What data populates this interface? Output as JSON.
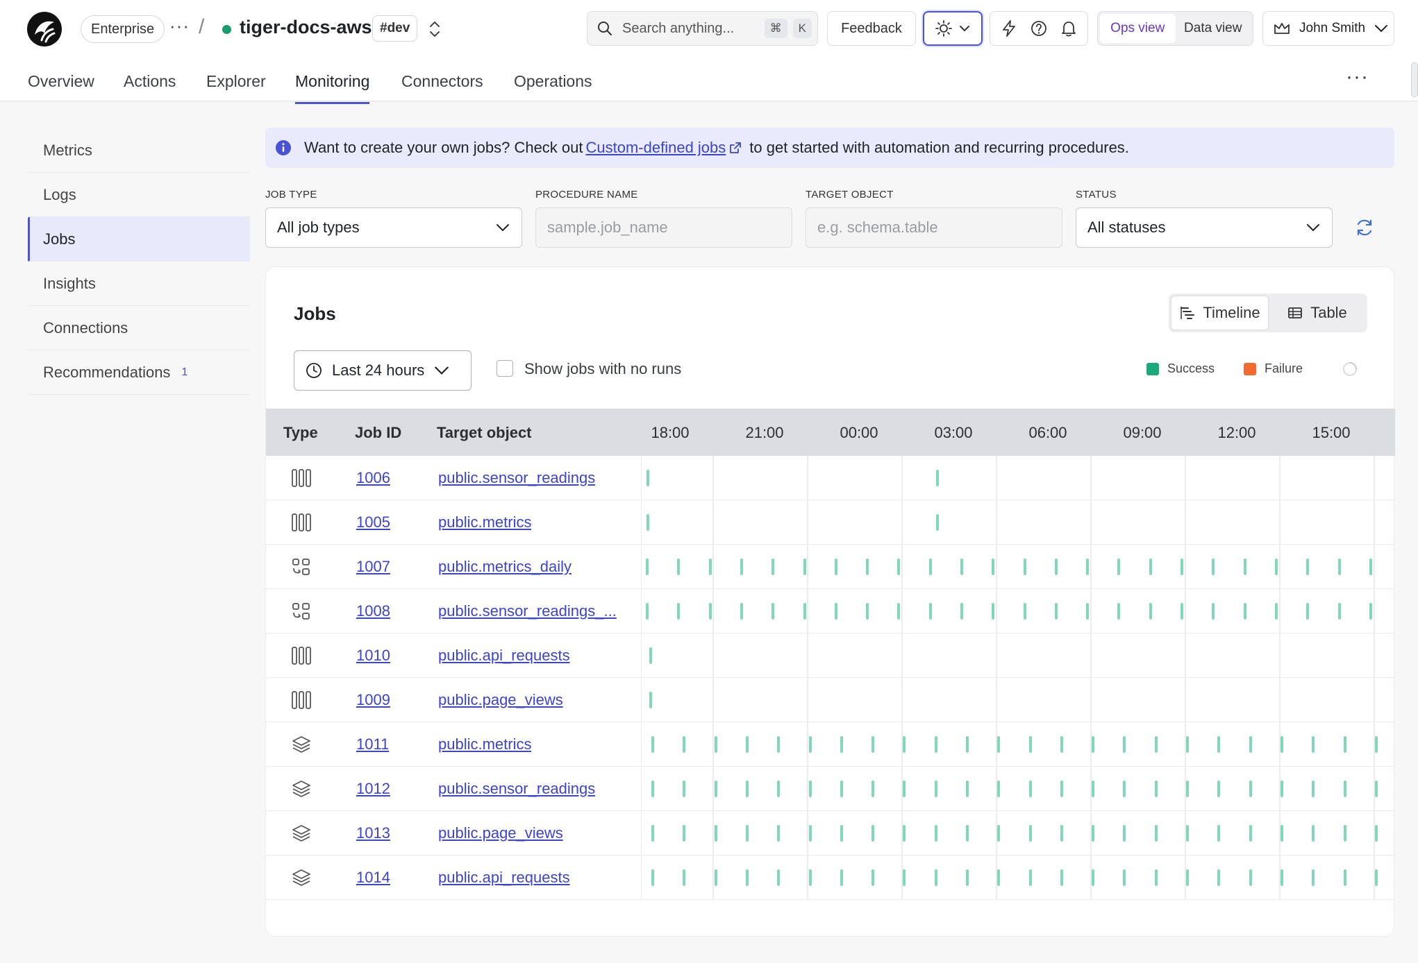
{
  "header": {
    "plan": "Enterprise",
    "more": "···",
    "separator": "/",
    "project": "tiger-docs-aws",
    "env": "#dev",
    "search_placeholder": "Search anything...",
    "search_shortcut_1": "⌘",
    "search_shortcut_2": "K",
    "feedback": "Feedback",
    "view_ops": "Ops view",
    "view_data": "Data view",
    "user": "John Smith"
  },
  "nav": {
    "tabs": [
      "Overview",
      "Actions",
      "Explorer",
      "Monitoring",
      "Connectors",
      "Operations"
    ],
    "active": "Monitoring",
    "more": "···"
  },
  "sidebar": {
    "items": [
      {
        "label": "Metrics",
        "badge": ""
      },
      {
        "label": "Logs",
        "badge": ""
      },
      {
        "label": "Jobs",
        "badge": ""
      },
      {
        "label": "Insights",
        "badge": ""
      },
      {
        "label": "Connections",
        "badge": ""
      },
      {
        "label": "Recommendations",
        "badge": "1"
      }
    ],
    "active": "Jobs"
  },
  "banner": {
    "prefix": "Want to create your own jobs? Check out",
    "link": "Custom-defined jobs",
    "suffix": "to get started with automation and recurring procedures."
  },
  "filters": {
    "job_type_label": "JOB TYPE",
    "job_type_value": "All job types",
    "procedure_label": "PROCEDURE NAME",
    "procedure_placeholder": "sample.job_name",
    "target_label": "TARGET OBJECT",
    "target_placeholder": "e.g. schema.table",
    "status_label": "STATUS",
    "status_value": "All statuses"
  },
  "jobs": {
    "title": "Jobs",
    "view_timeline": "Timeline",
    "view_table": "Table",
    "range": "Last 24 hours",
    "show_no_runs": "Show jobs with no runs",
    "legend": [
      {
        "label": "Success",
        "color": "#1aa97a"
      },
      {
        "label": "Failure",
        "color": "#f26a2e"
      }
    ],
    "columns": {
      "type": "Type",
      "job_id": "Job ID",
      "target": "Target object"
    },
    "time_ticks": [
      "18:00",
      "21:00",
      "00:00",
      "03:00",
      "06:00",
      "09:00",
      "12:00",
      "15:00"
    ],
    "rows": [
      {
        "type": "columnstore-icon",
        "id": "1006",
        "target": "public.sensor_readings",
        "runs": [
          0.006,
          0.39
        ]
      },
      {
        "type": "columnstore-icon",
        "id": "1005",
        "target": "public.metrics",
        "runs": [
          0.006,
          0.39
        ]
      },
      {
        "type": "refresh-cagg-icon",
        "id": "1007",
        "target": "public.metrics_daily",
        "runs": "hourly"
      },
      {
        "type": "refresh-cagg-icon",
        "id": "1008",
        "target": "public.sensor_readings_...",
        "runs": "hourly"
      },
      {
        "type": "columnstore-icon",
        "id": "1010",
        "target": "public.api_requests",
        "runs": [
          0.01
        ]
      },
      {
        "type": "columnstore-icon",
        "id": "1009",
        "target": "public.page_views",
        "runs": [
          0.01
        ]
      },
      {
        "type": "layers-icon",
        "id": "1011",
        "target": "public.metrics",
        "runs": "hourly-offset"
      },
      {
        "type": "layers-icon",
        "id": "1012",
        "target": "public.sensor_readings",
        "runs": "hourly-offset"
      },
      {
        "type": "layers-icon",
        "id": "1013",
        "target": "public.page_views",
        "runs": "hourly-offset"
      },
      {
        "type": "layers-icon",
        "id": "1014",
        "target": "public.api_requests",
        "runs": "hourly-offset"
      }
    ],
    "tick_color": "#7fd9b8"
  }
}
